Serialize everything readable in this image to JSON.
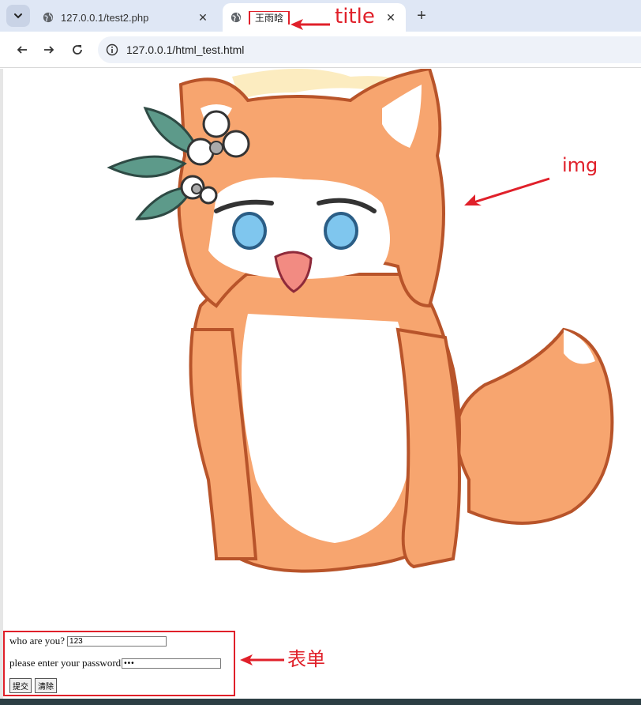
{
  "browser": {
    "tabs": [
      {
        "title": "127.0.0.1/test2.php",
        "active": false
      },
      {
        "title": "王雨晗",
        "active": true
      }
    ],
    "url": "127.0.0.1/html_test.html"
  },
  "annotations": {
    "title": "title",
    "img": "img",
    "form": "表单"
  },
  "form": {
    "name_label": "who are you?",
    "name_value": "123",
    "password_label": "please enter your password",
    "password_value": "•••",
    "submit_label": "提交",
    "reset_label": "清除"
  },
  "colors": {
    "annotation": "#e0202a",
    "tabstrip": "#dfe7f5",
    "fox_orange": "#f7a56f",
    "fox_outline": "#b8542a"
  }
}
